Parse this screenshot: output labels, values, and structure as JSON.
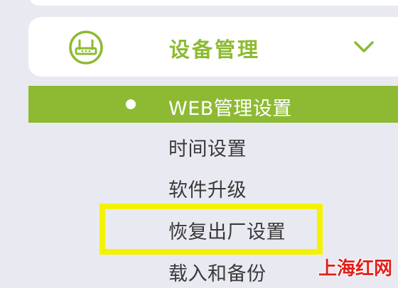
{
  "section": {
    "title": "设备管理",
    "icon": "router-icon",
    "expand_icon": "chevron-down-icon",
    "accent_color": "#8dba32"
  },
  "menu": {
    "items": [
      {
        "label": "WEB管理设置",
        "active": true
      },
      {
        "label": "时间设置",
        "active": false
      },
      {
        "label": "软件升级",
        "active": false
      },
      {
        "label": "恢复出厂设置",
        "active": false,
        "highlighted": true
      },
      {
        "label": "载入和备份",
        "active": false
      }
    ],
    "active_bg_color": "#8dba32",
    "highlight_color": "#f3f300"
  },
  "watermark": {
    "text": "上海红网"
  }
}
